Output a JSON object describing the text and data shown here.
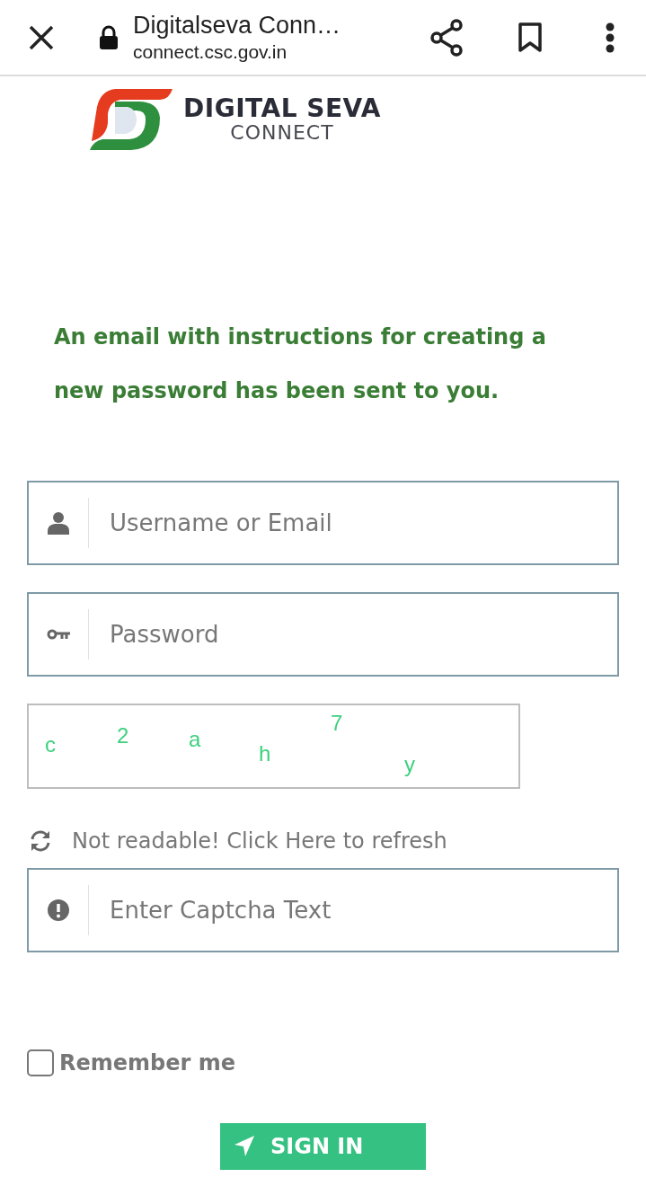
{
  "browser": {
    "page_title": "Digitalseva Conn…",
    "url": "connect.csc.gov.in"
  },
  "logo": {
    "title": "DIGITAL SEVA",
    "subtitle": "CONNECT"
  },
  "message": "An email with instructions for creating a new password has been sent to you.",
  "fields": [
    {
      "kind": "user",
      "placeholder": "Username or Email"
    },
    {
      "kind": "key",
      "placeholder": "Password"
    }
  ],
  "captcha": {
    "characters": [
      "c",
      "2",
      "a",
      "h",
      "7",
      "y"
    ]
  },
  "refresh_link": "Not readable! Click Here to refresh",
  "captcha_field": {
    "kind": "alert",
    "placeholder": "Enter Captcha Text"
  },
  "remember": {
    "label": "Remember me",
    "checked": false
  },
  "sign_in": "SIGN IN"
}
